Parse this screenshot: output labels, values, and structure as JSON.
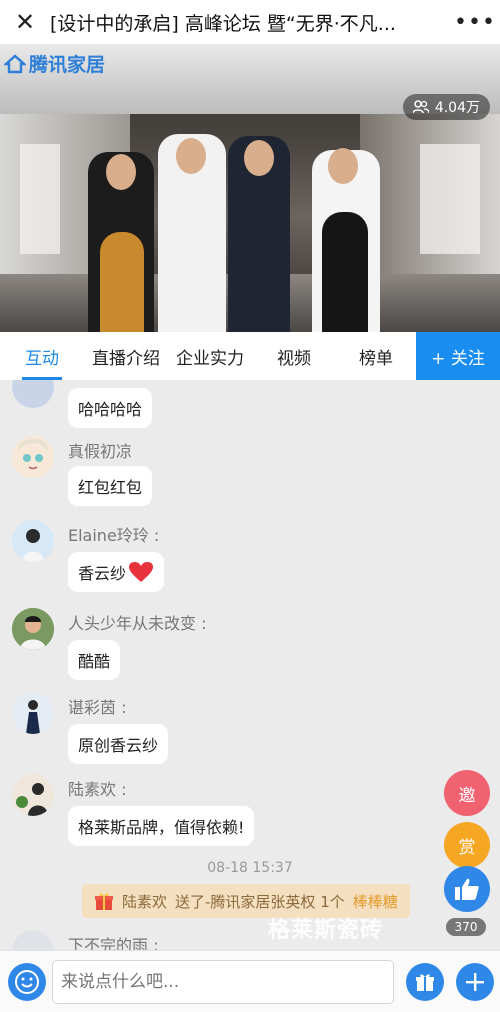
{
  "titlebar": {
    "close_icon": "close-icon",
    "title": "[设计中的承启] 高峰论坛 暨“无界·不凡...",
    "more_label": "•••"
  },
  "video": {
    "brand_name": "腾讯家居",
    "viewers": "4.04万"
  },
  "tabs": [
    {
      "label": "互动",
      "active": true
    },
    {
      "label": "直播介绍"
    },
    {
      "label": "企业实力"
    },
    {
      "label": "视频"
    },
    {
      "label": "榜单"
    }
  ],
  "follow_label": "+ 关注",
  "chat": {
    "messages": [
      {
        "name": "",
        "text": "哈哈哈哈"
      },
      {
        "name": "真假初凉",
        "text": "红包红包"
      },
      {
        "name": "Elaine玲玲 :",
        "text": "香云纱"
      },
      {
        "name": "人头少年从未改变 :",
        "text": "酷酷"
      },
      {
        "name": "谌彩茵 :",
        "text": "原创香云纱"
      },
      {
        "name": "陆素欢 :",
        "text": "格莱斯品牌，值得依赖!"
      }
    ],
    "timestamp": "08-18 15:37",
    "gift": {
      "sender": "陆素欢",
      "text": "送了-腾讯家居张英权 1个",
      "item": "棒棒糖"
    },
    "last_name": "下不完的雨 :"
  },
  "side": {
    "invite_label": "邀",
    "reward_label": "赏",
    "like_count": "370"
  },
  "watermark": "格莱斯瓷砖",
  "input": {
    "placeholder": "来说点什么吧..."
  },
  "colors": {
    "accent": "#1d88e5",
    "follow_bg": "#1a8ef0",
    "heart": "#e8333c"
  }
}
